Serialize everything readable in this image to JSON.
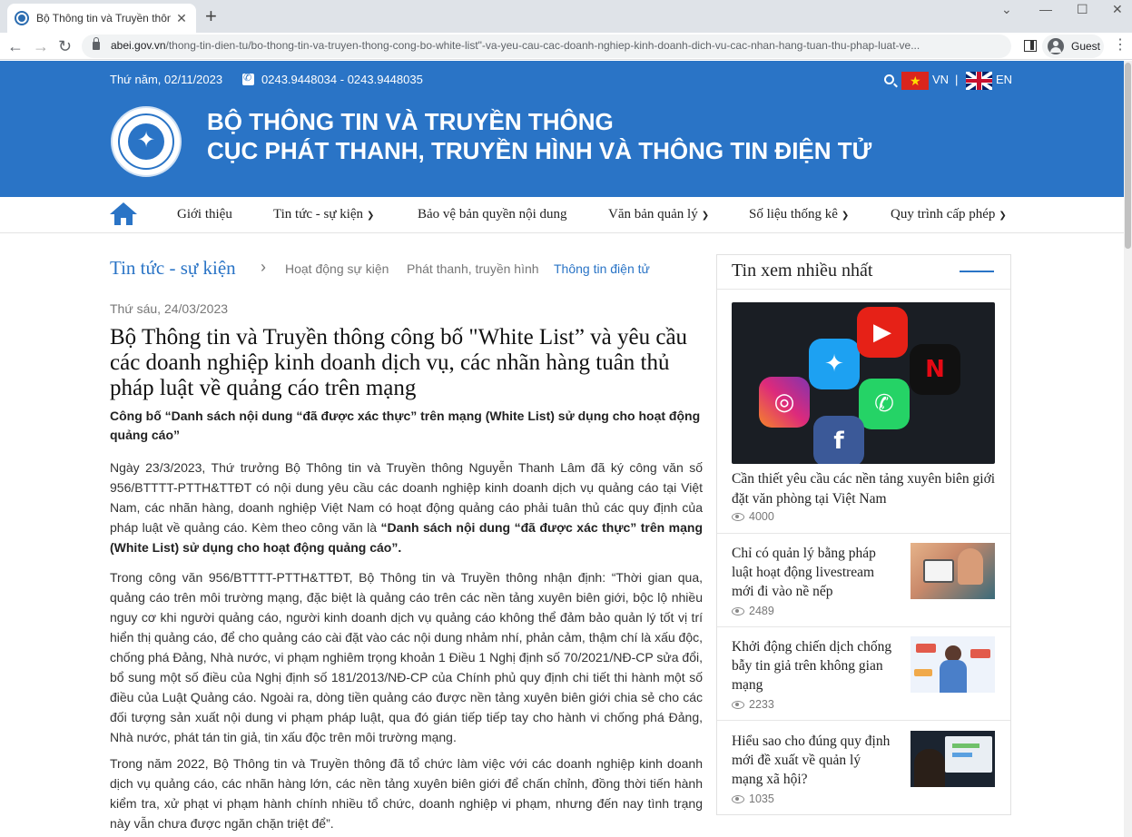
{
  "browser": {
    "tab_title": "Bộ Thông tin và Truyền thông cô",
    "url_domain": "abei.gov.vn",
    "url_path": "/thong-tin-dien-tu/bo-thong-tin-va-truyen-thong-cong-bo-white-list\"-va-yeu-cau-cac-doanh-nghiep-kinh-doanh-dich-vu-cac-nhan-hang-tuan-thu-phap-luat-ve...",
    "profile_label": "Guest"
  },
  "header": {
    "date": "Thứ năm, 02/11/2023",
    "phone": "0243.9448034 - 0243.9448035",
    "lang_vn": "VN",
    "lang_sep": "|",
    "lang_en": "EN",
    "org_line1": "BỘ THÔNG TIN VÀ TRUYỀN THÔNG",
    "org_line2": "CỤC PHÁT THANH, TRUYỀN HÌNH VÀ THÔNG TIN ĐIỆN TỬ"
  },
  "nav": {
    "items": [
      "Giới thiệu",
      "Tin tức - sự kiện",
      "Bảo vệ bản quyền nội dung",
      "Văn bản quản lý",
      "Số liệu thống kê",
      "Quy trình cấp phép"
    ]
  },
  "breadcrumb": {
    "main": "Tin tức - sự kiện",
    "sub1": "Hoạt động sự kiện",
    "sub2": "Phát thanh, truyền hình",
    "sub3": "Thông tin điện tử"
  },
  "article": {
    "date": "Thứ sáu, 24/03/2023",
    "title": "Bộ Thông tin và Truyền thông công bố \"White List” và yêu cầu các doanh nghiệp kinh doanh dịch vụ, các nhãn hàng tuân thủ pháp luật về quảng cáo trên mạng",
    "sapo": "Công bố “Danh sách nội dung “đã được xác thực” trên mạng (White List) sử dụng cho hoạt động quảng cáo”",
    "p1_text": "Ngày 23/3/2023, Thứ trưởng Bộ Thông tin và Truyền thông Nguyễn Thanh Lâm đã ký công văn số 956/BTTTT-PTTH&TTĐT có nội dung yêu cầu các doanh nghiệp kinh doanh dịch vụ quảng cáo tại Việt Nam, các nhãn hàng, doanh nghiệp Việt Nam có hoạt động quảng cáo phải tuân thủ các quy định của pháp luật về quảng cáo. Kèm theo công văn là ",
    "p1_bold": "“Danh sách nội dung “đã được xác thực” trên mạng (White List) sử dụng cho hoạt động quảng cáo”.",
    "p2": "Trong công văn 956/BTTTT-PTTH&TTĐT, Bộ Thông tin và Truyền thông nhận định: “Thời gian qua, quảng cáo trên môi trường mạng, đặc biệt là quảng cáo trên các nền tảng xuyên biên giới, bộc lộ nhiều nguy cơ khi người quảng cáo, người kinh doanh dịch vụ quảng cáo không thể đảm bảo quản lý tốt vị trí hiển thị quảng cáo, để cho quảng cáo cài đặt vào các nội dung nhảm nhí, phản cảm, thậm chí là xấu độc, chống phá Đảng, Nhà nước, vi phạm nghiêm trọng khoản 1 Điều 1 Nghị định số 70/2021/NĐ-CP sửa đổi, bổ sung một số điều của Nghị định số 181/2013/NĐ-CP của Chính phủ quy định chi tiết thi hành một số điều của Luật Quảng cáo. Ngoài ra, dòng tiền quảng cáo được nền tảng xuyên biên giới chia sẻ cho các đối tượng sản xuất nội dung vi phạm pháp luật, qua đó gián tiếp tiếp tay cho hành vi chống phá Đảng, Nhà nước, phát tán tin giả, tin xấu độc trên môi trường mạng.",
    "p3": "Trong năm 2022, Bộ Thông tin và Truyền thông đã tổ chức làm việc với các doanh nghiệp kinh doanh dịch vụ quảng cáo, các nhãn hàng lớn, các nền tảng xuyên biên giới để chấn chỉnh, đồng thời tiến hành kiểm tra, xử phạt vi phạm hành chính nhiều tổ chức, doanh nghiệp vi phạm, nhưng đến nay tình trạng này vẫn chưa được ngăn chặn triệt để”."
  },
  "sidebar": {
    "title": "Tin xem nhiều nhất",
    "featured": {
      "title": "Cần thiết yêu cầu các nền tảng xuyên biên giới đặt văn phòng tại Việt Nam",
      "views": "4000"
    },
    "items": [
      {
        "title": "Chỉ có quản lý bằng pháp luật hoạt động livestream mới đi vào nề nếp",
        "views": "2489"
      },
      {
        "title": "Khởi động chiến dịch chống bẫy tin giả trên không gian mạng",
        "views": "2233"
      },
      {
        "title": "Hiểu sao cho đúng quy định mới đề xuất về quản lý mạng xã hội?",
        "views": "1035"
      }
    ]
  }
}
